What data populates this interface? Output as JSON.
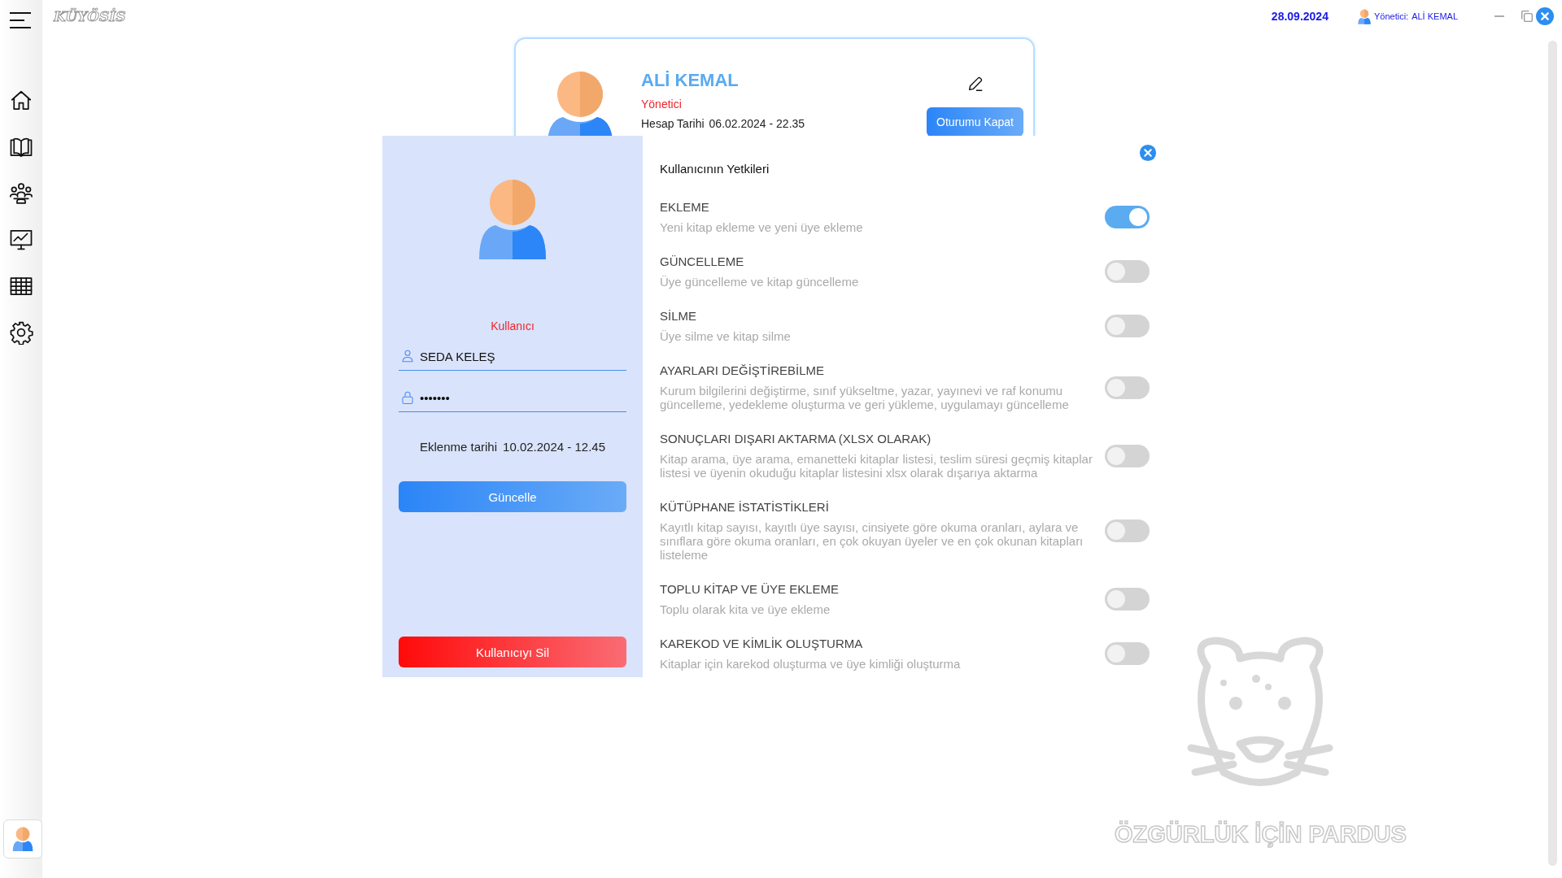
{
  "app": {
    "logo": "KÜYÖSİS",
    "date": "28.09.2024",
    "user_label": "Yönetici:",
    "user_name": "ALİ KEMAL"
  },
  "profile": {
    "name": "ALİ KEMAL",
    "role": "Yönetici",
    "account_date_label": "Hesap Tarihi",
    "account_date": "06.02.2024 - 22.35",
    "logout_button": "Oturumu Kapat"
  },
  "user_dialog": {
    "role": "Kullanıcı",
    "username": "SEDA KELEŞ",
    "password": "•••••••",
    "added_label": "Eklenme tarihi",
    "added_date": "10.02.2024 - 12.45",
    "update_button": "Güncelle",
    "delete_button": "Kullanıcıyı Sil",
    "permissions_title": "Kullanıcının Yetkileri",
    "permissions": [
      {
        "title": "EKLEME",
        "description": "Yeni kitap ekleme ve yeni üye ekleme",
        "on": true
      },
      {
        "title": "GÜNCELLEME",
        "description": "Üye güncelleme ve kitap güncelleme",
        "on": false
      },
      {
        "title": "SİLME",
        "description": "Üye silme ve kitap silme",
        "on": false
      },
      {
        "title": "AYARLARI DEĞİŞTİREBİLME",
        "description": "Kurum bilgilerini değiştirme, sınıf yükseltme, yazar, yayınevi ve raf konumu güncelleme, yedekleme oluşturma ve geri yükleme, uygulamayı güncelleme",
        "on": false
      },
      {
        "title": "SONUÇLARI DIŞARI AKTARMA (XLSX OLARAK)",
        "description": "Kitap arama, üye arama, emanetteki kitaplar listesi, teslim süresi geçmiş kitaplar listesi ve üyenin okuduğu kitaplar listesini xlsx olarak dışarıya aktarma",
        "on": false
      },
      {
        "title": "KÜTÜPHANE İSTATİSTİKLERİ",
        "description": "Kayıtlı kitap sayısı, kayıtlı üye sayısı, cinsiyete göre okuma oranları, aylara ve sınıflara göre okuma oranları, en çok okuyan üyeler ve en çok okunan kitapları listeleme",
        "on": false
      },
      {
        "title": "TOPLU KİTAP VE ÜYE EKLEME",
        "description": "Toplu olarak kita ve üye ekleme",
        "on": false
      },
      {
        "title": "KAREKOD VE KİMLİK OLUŞTURMA",
        "description": "Kitaplar için karekod oluşturma ve üye kimliği oluşturma",
        "on": false
      }
    ]
  },
  "background_text": "ÖZGÜRLÜK İÇİN PARDUS"
}
